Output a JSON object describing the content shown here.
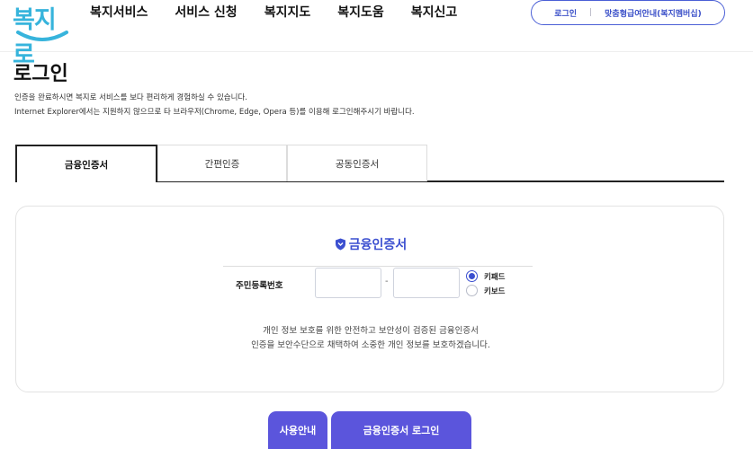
{
  "header": {
    "logo_text": "복지로",
    "nav": [
      "복지서비스",
      "서비스 신청",
      "복지지도",
      "복지도움",
      "복지신고"
    ],
    "util_login": "로그인",
    "util_membership": "맞춤형급여안내(복지멤버십)"
  },
  "page": {
    "title": "로그인",
    "desc_line1": "인증을 완료하시면 복지로 서비스를 보다 편리하게 경험하실 수 있습니다.",
    "desc_line2": "Internet Explorer에서는 지원하지 않으므로 타 브라우저(Chrome, Edge, Opera 등)를 이용해 로그인해주시기 바랍니다."
  },
  "tabs": [
    {
      "label": "금융인증서",
      "active": true
    },
    {
      "label": "간편인증",
      "active": false
    },
    {
      "label": "공동인증서",
      "active": false
    }
  ],
  "panel": {
    "title": "금융인증서",
    "rrn_label": "주민등록번호",
    "rrn_first_value": "",
    "rrn_second_value": "",
    "rrn_separator": "-",
    "keypad_option": "키패드",
    "keyboard_option": "키보드",
    "selected_input_mode": "키패드",
    "notice_line1": "개인 정보 보호를 위한 안전하고 보안성이 검증된 금융인증서",
    "notice_line2": "인증을 보안수단으로 채택하여 소중한 개인 정보를 보호하겠습니다."
  },
  "buttons": {
    "guide": "사용안내",
    "login": "금융인증서 로그인"
  },
  "colors": {
    "brand_blue": "#37b4dc",
    "accent": "#3b4fd0",
    "button": "#5b55dc"
  }
}
